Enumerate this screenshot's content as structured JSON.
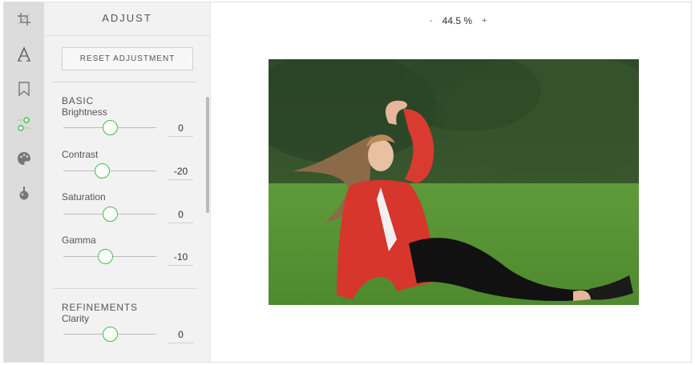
{
  "panel": {
    "title": "ADJUST",
    "reset_label": "RESET ADJUSTMENT"
  },
  "sections": {
    "basic": "BASIC",
    "refinements": "REFINEMENTS"
  },
  "controls": {
    "brightness": {
      "label": "Brightness",
      "value": "0"
    },
    "contrast": {
      "label": "Contrast",
      "value": "-20"
    },
    "saturation": {
      "label": "Saturation",
      "value": "0"
    },
    "gamma": {
      "label": "Gamma",
      "value": "-10"
    },
    "clarity": {
      "label": "Clarity",
      "value": "0"
    }
  },
  "zoom": {
    "minus": "-",
    "level": "44.5 %",
    "plus": "+"
  },
  "rail": {
    "items": [
      "crop-icon",
      "text-icon",
      "bookmark-icon",
      "adjust-sliders-icon",
      "palette-icon",
      "brush-icon"
    ],
    "active": "adjust-sliders-icon"
  },
  "colors": {
    "accent": "#3fbf3f",
    "rail_bg": "#dcdcdc",
    "panel_bg": "#f2f2f2"
  }
}
